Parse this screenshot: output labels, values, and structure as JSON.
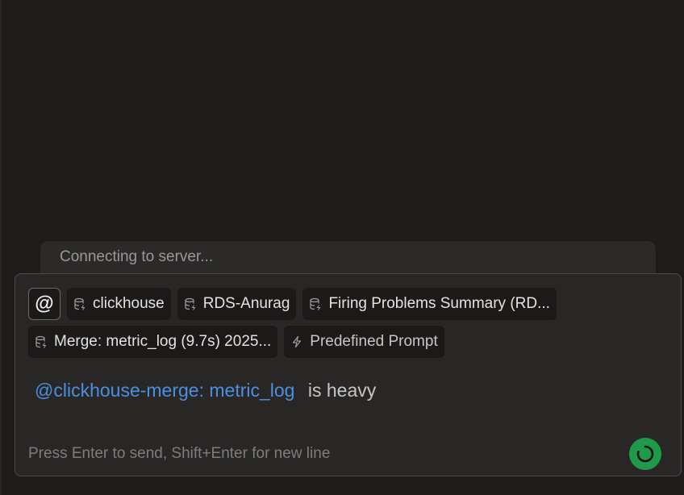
{
  "status": {
    "text": "Connecting to server..."
  },
  "composer": {
    "mention_button_label": "@",
    "chips": [
      {
        "label": "clickhouse",
        "icon": "database-icon"
      },
      {
        "label": "RDS-Anurag",
        "icon": "database-icon"
      },
      {
        "label": "Firing Problems Summary (RD...",
        "icon": "database-icon"
      },
      {
        "label": "Merge: metric_log (9.7s) 2025...",
        "icon": "database-icon"
      },
      {
        "label": "Predefined Prompt",
        "icon": "lightning-icon"
      }
    ],
    "message": {
      "mention": "@clickhouse-merge: metric_log",
      "text": "is heavy"
    },
    "hint": "Press Enter to send, Shift+Enter for new line",
    "send_icon": "spinner-icon"
  },
  "colors": {
    "background": "#1e1c1b",
    "mention": "#4b8fe0",
    "send_button": "#1f9a4a"
  }
}
